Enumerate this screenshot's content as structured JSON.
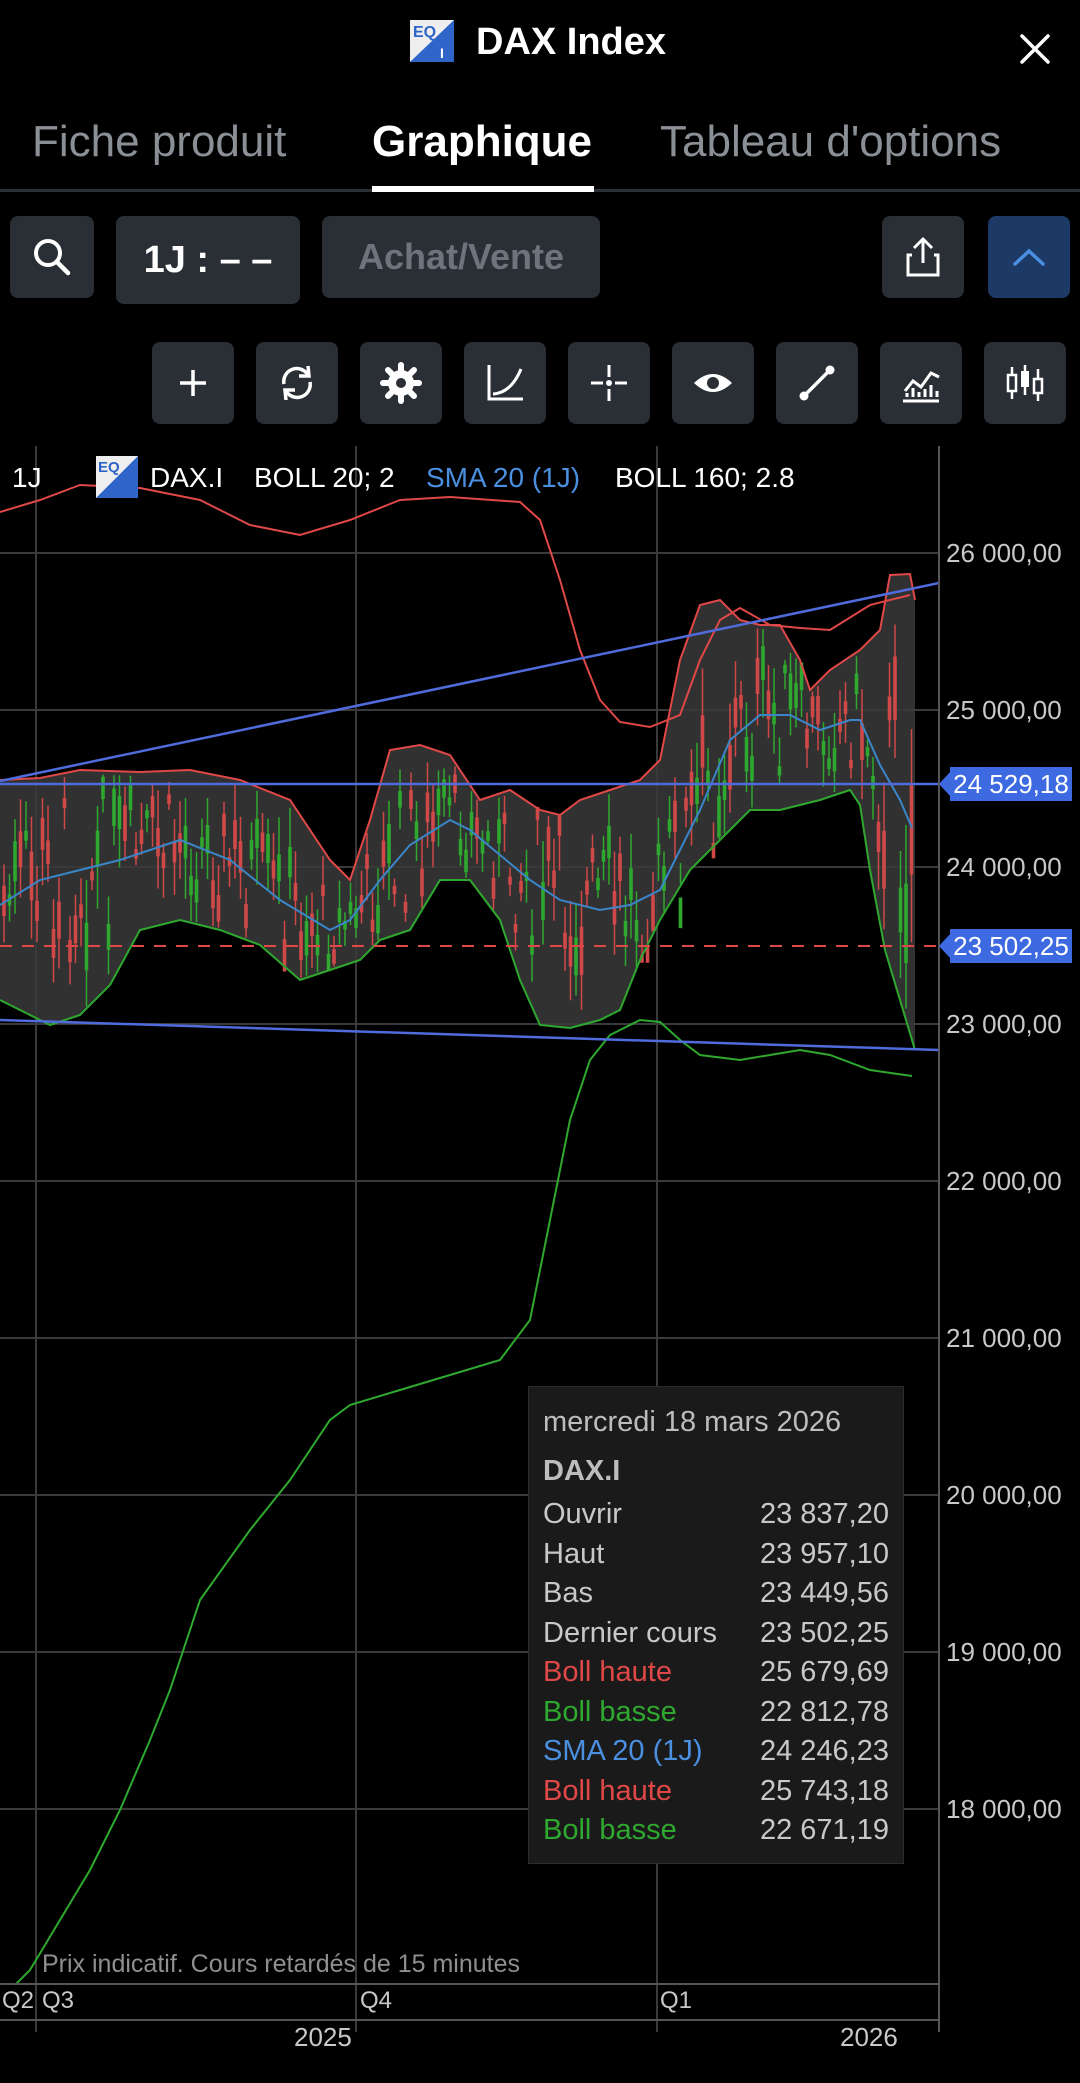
{
  "header": {
    "title": "DAX Index",
    "logo_text": "EQ I"
  },
  "tabs": [
    {
      "label": "Fiche produit",
      "active": false
    },
    {
      "label": "Graphique",
      "active": true
    },
    {
      "label": "Tableau d'options",
      "active": false
    }
  ],
  "toolbar": {
    "interval": "1J : – –",
    "trade_label": "Achat/Vente"
  },
  "tools": [
    "plus-icon",
    "refresh-icon",
    "gear-icon",
    "curve-icon",
    "crosshair-icon",
    "eye-icon",
    "draw-line-icon",
    "indicator-icon",
    "candles-icon"
  ],
  "legend": {
    "interval": "1J",
    "symbol": "DAX.I",
    "items": [
      {
        "text": "BOLL 20; 2",
        "color": "#ffffff"
      },
      {
        "text": "SMA 20 (1J)",
        "color": "#4a8fe0"
      },
      {
        "text": "BOLL 160; 2.8",
        "color": "#ffffff"
      }
    ]
  },
  "y_axis": {
    "labels": [
      "26 000,00",
      "25 000,00",
      "24 000,00",
      "23 000,00",
      "22 000,00",
      "21 000,00",
      "20 000,00",
      "19 000,00",
      "18 000,00"
    ]
  },
  "price_tags": {
    "resistance": "24 529,18",
    "last": "23 502,25"
  },
  "x_axis": {
    "quarters": [
      "Q2",
      "Q3",
      "Q4",
      "Q1"
    ],
    "years": [
      "2025",
      "2026"
    ]
  },
  "disclaimer": "Prix indicatif. Cours retardés de 15 minutes",
  "tooltip": {
    "date": "mercredi 18 mars 2026",
    "symbol": "DAX.I",
    "rows": [
      {
        "label": "Ouvrir",
        "value": "23 837,20",
        "color": "#c8c8c8"
      },
      {
        "label": "Haut",
        "value": "23 957,10",
        "color": "#c8c8c8"
      },
      {
        "label": "Bas",
        "value": "23 449,56",
        "color": "#c8c8c8"
      },
      {
        "label": "Dernier cours",
        "value": "23 502,25",
        "color": "#c8c8c8"
      },
      {
        "label": "Boll haute",
        "value": "25 679,69",
        "color": "#e04848"
      },
      {
        "label": "Boll basse",
        "value": "22 812,78",
        "color": "#2fa82f"
      },
      {
        "label": "SMA 20 (1J)",
        "value": "24 246,23",
        "color": "#4a8fe0"
      },
      {
        "label": "Boll haute",
        "value": "25 743,18",
        "color": "#e04848"
      },
      {
        "label": "Boll basse",
        "value": "22 671,19",
        "color": "#2fa82f"
      }
    ]
  },
  "colors": {
    "up": "#2fa82f",
    "down": "#d04848",
    "sma": "#3a86c8",
    "trend": "#4f6bdc",
    "accent": "#3d6ae0"
  }
}
